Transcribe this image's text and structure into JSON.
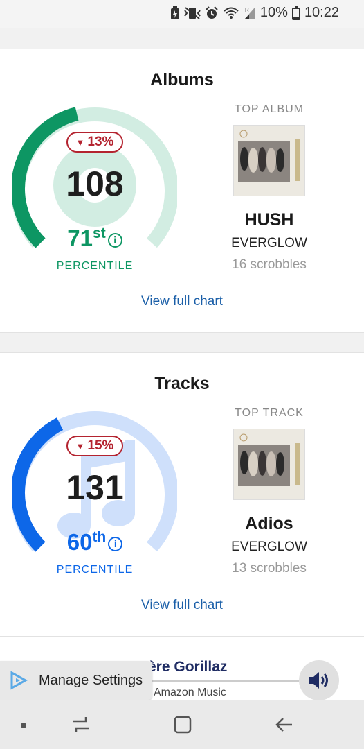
{
  "status_bar": {
    "battery": "10%",
    "time": "10:22"
  },
  "albums": {
    "title": "Albums",
    "change": "13%",
    "count": "108",
    "percentile_value": "71",
    "percentile_suffix": "st",
    "percentile_label": "PERCENTILE",
    "top_label": "TOP ALBUM",
    "item_title": "HUSH",
    "item_artist": "EVERGLOW",
    "item_scrobbles": "16 scrobbles",
    "view_link": "View full chart",
    "accent": "#0d9663",
    "gauge_fill_fraction": 0.45
  },
  "tracks": {
    "title": "Tracks",
    "change": "15%",
    "count": "131",
    "percentile_value": "60",
    "percentile_suffix": "th",
    "percentile_label": "PERCENTILE",
    "top_label": "TOP TRACK",
    "item_title": "Adios",
    "item_artist": "EVERGLOW",
    "item_scrobbles": "13 scrobbles",
    "view_link": "View full chart",
    "accent": "#0d67e8",
    "gauge_fill_fraction": 0.4
  },
  "ad": {
    "manage_settings": "Manage Settings",
    "title": "ère Gorillaz",
    "subtitle": "Amazon Music"
  },
  "icons": [
    "battery-saver-icon",
    "vibrate-icon",
    "alarm-icon",
    "wifi-icon",
    "signal-icon",
    "battery-icon",
    "info-icon",
    "music-note-icon",
    "speaker-icon",
    "play-arrow-icon",
    "nav-dot-icon",
    "recent-apps-icon",
    "home-icon",
    "back-icon"
  ],
  "colors": {
    "decline": "#b4232f",
    "link": "#1b5fa8"
  }
}
